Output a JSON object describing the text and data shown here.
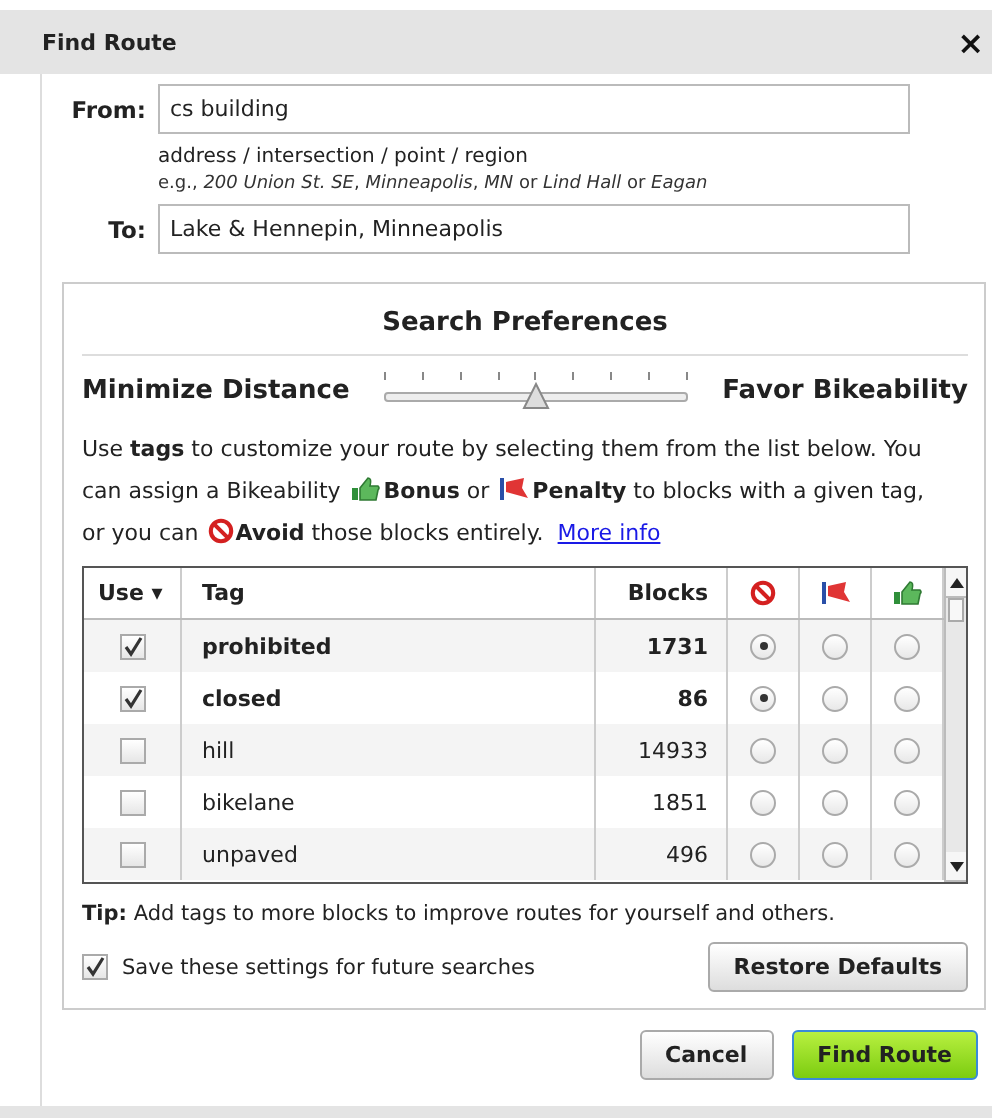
{
  "window": {
    "title": "Find Route",
    "close": "×"
  },
  "from": {
    "label": "From:",
    "value": "cs building"
  },
  "hint": {
    "line_1": "address / intersection / point / region",
    "line_2": "e.g., *200 Union St. SE*, *Minneapolis*, *MN* or *Lind Hall* or *Eagan*"
  },
  "to": {
    "label": "To:",
    "value": "Lake & Hennepin, Minneapolis"
  },
  "preferences": {
    "title": "Search Preferences",
    "slider": {
      "left_label": "Minimize Distance",
      "right_label": "Favor Bikeability",
      "level": 0.5
    },
    "help": {
      "part_1": "Use **tags** to customize your route by selecting them from the list below. You can assign a Bikeability ",
      "part_2": "**Bonus** or ",
      "part_3": "**Penalty** to blocks with a given tag, or you can ",
      "part_4": "**Avoid** those blocks entirely.",
      "link": "More info"
    },
    "table": {
      "columns": [
        "Use ▾",
        "Tag",
        "Blocks"
      ],
      "rows": [
        {
          "checked": true,
          "tag": "prohibited",
          "blocks": "1731",
          "avoid": true,
          "penalty": false,
          "bonus": false
        },
        {
          "checked": true,
          "tag": "closed",
          "blocks": "86",
          "avoid": true,
          "penalty": false,
          "bonus": false
        },
        {
          "checked": false,
          "tag": "hill",
          "blocks": "14933",
          "avoid": false,
          "penalty": false,
          "bonus": false
        },
        {
          "checked": false,
          "tag": "bikelane",
          "blocks": "1851",
          "avoid": false,
          "penalty": false,
          "bonus": false
        },
        {
          "checked": false,
          "tag": "unpaved",
          "blocks": "496",
          "avoid": false,
          "penalty": false,
          "bonus": false
        }
      ]
    },
    "tip": "**Tip:** Add tags to more blocks to improve routes for yourself and others.",
    "save": {
      "label": "Save these settings for future searches",
      "checked": true
    },
    "restore_button": "Restore Defaults"
  },
  "buttons": [
    {
      "label": "Cancel",
      "kind": "secondary"
    },
    {
      "label": "Find Route",
      "kind": "primary"
    }
  ]
}
